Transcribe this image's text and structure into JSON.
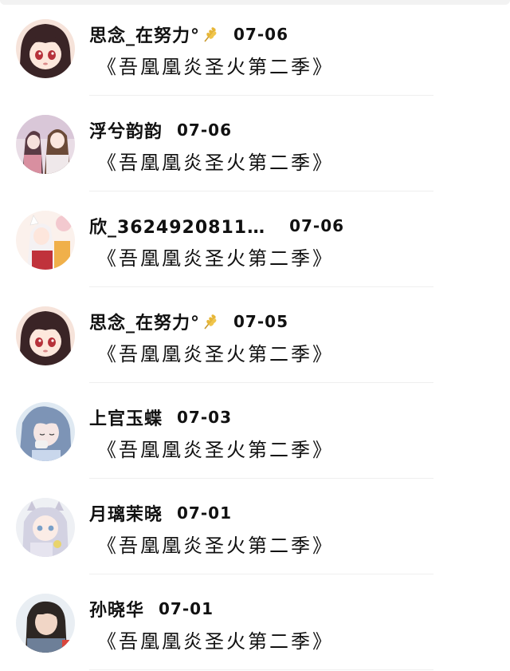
{
  "comments": [
    {
      "name": "思念_在努力°",
      "has_wheat": true,
      "date": "07-06",
      "title": "《吾凰凰炎圣火第二季》",
      "avatar": "avatar-anime-girl-dark-hair"
    },
    {
      "name": "浮兮韵韵",
      "has_wheat": false,
      "date": "07-06",
      "title": "《吾凰凰炎圣火第二季》",
      "avatar": "avatar-anime-couple"
    },
    {
      "name": "欣_3624920811…",
      "has_wheat": false,
      "date": "07-06",
      "title": "《吾凰凰炎圣火第二季》",
      "avatar": "avatar-anime-white-hair"
    },
    {
      "name": "思念_在努力°",
      "has_wheat": true,
      "date": "07-05",
      "title": "《吾凰凰炎圣火第二季》",
      "avatar": "avatar-anime-girl-dark-hair"
    },
    {
      "name": "上官玉蝶",
      "has_wheat": false,
      "date": "07-03",
      "title": "《吾凰凰炎圣火第二季》",
      "avatar": "avatar-anime-blue-hair"
    },
    {
      "name": "月璃茉晓",
      "has_wheat": false,
      "date": "07-01",
      "title": "《吾凰凰炎圣火第二季》",
      "avatar": "avatar-anime-silver-hair"
    },
    {
      "name": "孙晓华",
      "has_wheat": false,
      "date": "07-01",
      "title": "《吾凰凰炎圣火第二季》",
      "avatar": "avatar-photo-woman"
    }
  ],
  "colors": {
    "text": "#111111",
    "divider": "#efefef",
    "background": "#ffffff"
  }
}
